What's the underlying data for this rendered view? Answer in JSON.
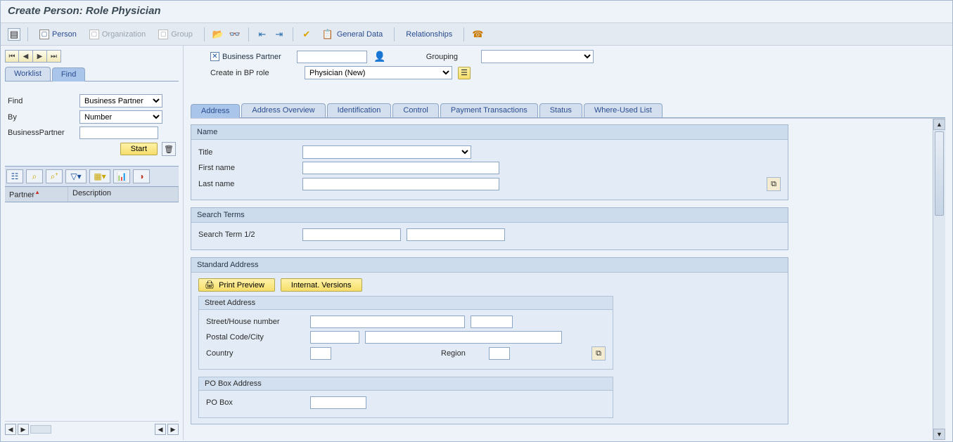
{
  "title": "Create Person: Role Physician",
  "apptoolbar": {
    "menu": "≡",
    "person": "Person",
    "organization": "Organization",
    "group": "Group",
    "general_data": "General Data",
    "relationships": "Relationships"
  },
  "left": {
    "tabs": {
      "worklist": "Worklist",
      "find": "Find"
    },
    "form": {
      "find_lbl": "Find",
      "find_val": "Business Partner",
      "by_lbl": "By",
      "by_val": "Number",
      "bp_lbl": "BusinessPartner",
      "bp_val": "",
      "start": "Start"
    },
    "grid": {
      "col1": "Partner",
      "col2": "Description"
    }
  },
  "header": {
    "bp_chklabel": "Business Partner",
    "bp_val": "",
    "grouping_lbl": "Grouping",
    "grouping_val": "",
    "createrole_lbl": "Create in BP role",
    "createrole_val": "Physician (New)"
  },
  "tabs": [
    "Address",
    "Address Overview",
    "Identification",
    "Control",
    "Payment Transactions",
    "Status",
    "Where-Used List"
  ],
  "active_tab": 0,
  "group_name": {
    "title": "Name",
    "title_lbl": "Title",
    "title_val": "",
    "first_lbl": "First name",
    "first_val": "",
    "last_lbl": "Last name",
    "last_val": ""
  },
  "group_search": {
    "title": "Search Terms",
    "lbl": "Search Term 1/2",
    "v1": "",
    "v2": ""
  },
  "group_addr": {
    "title": "Standard Address",
    "print": "Print Preview",
    "intl": "Internat. Versions",
    "street_title": "Street Address",
    "street_lbl": "Street/House number",
    "postal_lbl": "Postal Code/City",
    "country_lbl": "Country",
    "region_lbl": "Region",
    "pobox_title": "PO Box Address",
    "pobox_lbl": "PO Box"
  }
}
